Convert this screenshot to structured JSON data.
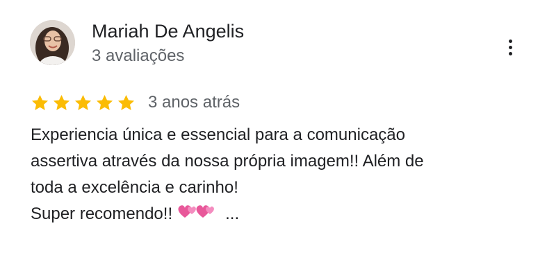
{
  "reviewer": {
    "name": "Mariah De Angelis",
    "meta": "3 avaliações"
  },
  "icons": {
    "menu": "more-vert-icon",
    "star": "star-icon",
    "hearts": "revolving-hearts-emoji"
  },
  "rating": {
    "stars": 5,
    "max": 5,
    "date": "3 anos atrás",
    "star_color": "#fbbc04"
  },
  "review": {
    "lines": [
      "Experiencia única e essencial para a comunicação",
      "assertiva através da nossa própria imagem!! Além de",
      "toda a excelência e carinho!",
      "Super recomendo!!"
    ],
    "more": "..."
  },
  "colors": {
    "primary_text": "#202124",
    "secondary_text": "#5f6368"
  }
}
